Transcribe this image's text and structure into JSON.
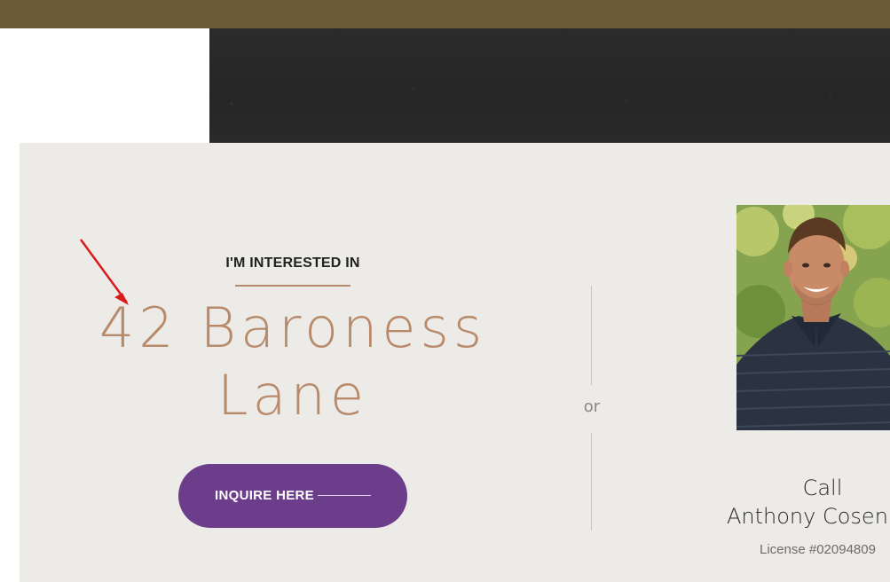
{
  "header": {
    "bar_color": "#6b5b37"
  },
  "inquiry": {
    "eyebrow": "I'M INTERESTED IN",
    "property_line1": "42 Baroness",
    "property_line2": "Lane",
    "button_label": "INQUIRE HERE",
    "accent_color": "#b88a6a",
    "button_color": "#6b3d8a"
  },
  "separator": {
    "or_label": "or"
  },
  "agent": {
    "call_label": "Call",
    "name": "Anthony Cosen",
    "license": "License #02094809",
    "photo_icon": "agent-portrait"
  },
  "annotation": {
    "arrow_color": "#d81b1b"
  }
}
